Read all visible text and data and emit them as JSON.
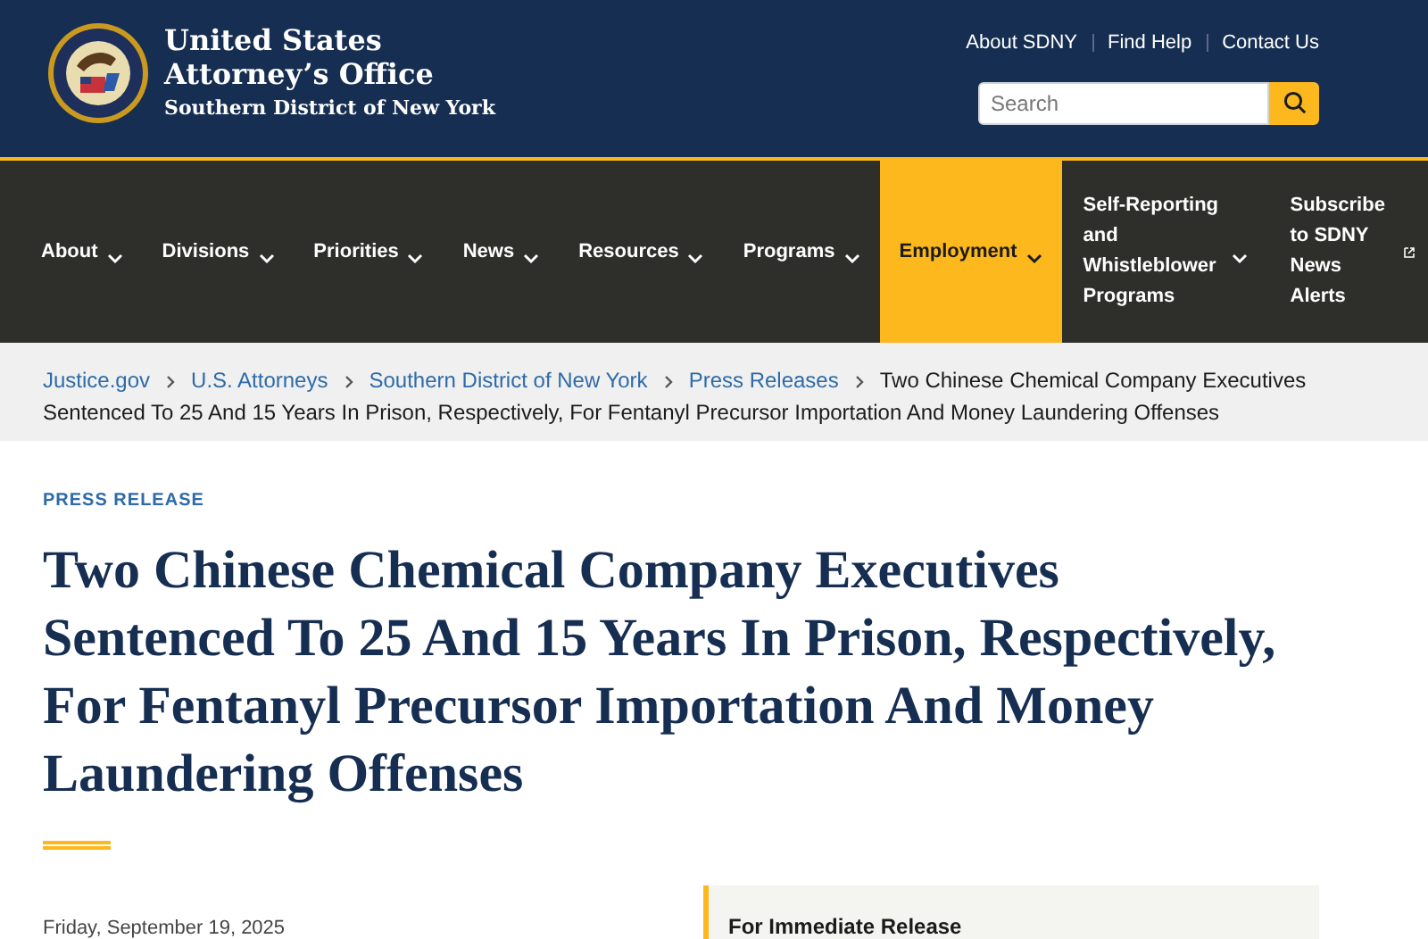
{
  "header": {
    "title_line_1": "United States",
    "title_line_2": "Attorney’s Office",
    "subtitle": "Southern District of New York",
    "utility_links": [
      "About SDNY",
      "Find Help",
      "Contact Us"
    ],
    "search": {
      "placeholder": "Search"
    }
  },
  "nav": {
    "items": [
      {
        "label": "About",
        "kind": "dropdown",
        "selected": false
      },
      {
        "label": "Divisions",
        "kind": "dropdown",
        "selected": false
      },
      {
        "label": "Priorities",
        "kind": "dropdown",
        "selected": false
      },
      {
        "label": "News",
        "kind": "dropdown",
        "selected": false
      },
      {
        "label": "Resources",
        "kind": "dropdown",
        "selected": false
      },
      {
        "label": "Programs",
        "kind": "dropdown",
        "selected": false
      },
      {
        "label": "Employment",
        "kind": "dropdown",
        "selected": true
      },
      {
        "label": "Self-Reporting and Whistleblower Programs",
        "kind": "dropdown",
        "selected": false
      },
      {
        "label": "Subscribe to SDNY News Alerts",
        "kind": "external",
        "selected": false
      }
    ]
  },
  "breadcrumb": [
    {
      "label": "Justice.gov",
      "kind": "link"
    },
    {
      "label": "U.S. Attorneys",
      "kind": "link"
    },
    {
      "label": "Southern District of New York",
      "kind": "link"
    },
    {
      "label": "Press Releases",
      "kind": "link"
    },
    {
      "label": "Two Chinese Chemical Company Executives Sentenced To 25 And 15 Years In Prison, Respectively, For Fentanyl Precursor Importation And Money Laundering Offenses",
      "kind": "current"
    }
  ],
  "article": {
    "eyebrow": "PRESS RELEASE",
    "title": "Two Chinese Chemical Company Executives Sentenced To 25 And 15 Years In Prison, Respectively, For Fentanyl Precursor Importation And Money Laundering Offenses",
    "date": "Friday, September 19, 2025",
    "release_box": "For Immediate Release"
  }
}
